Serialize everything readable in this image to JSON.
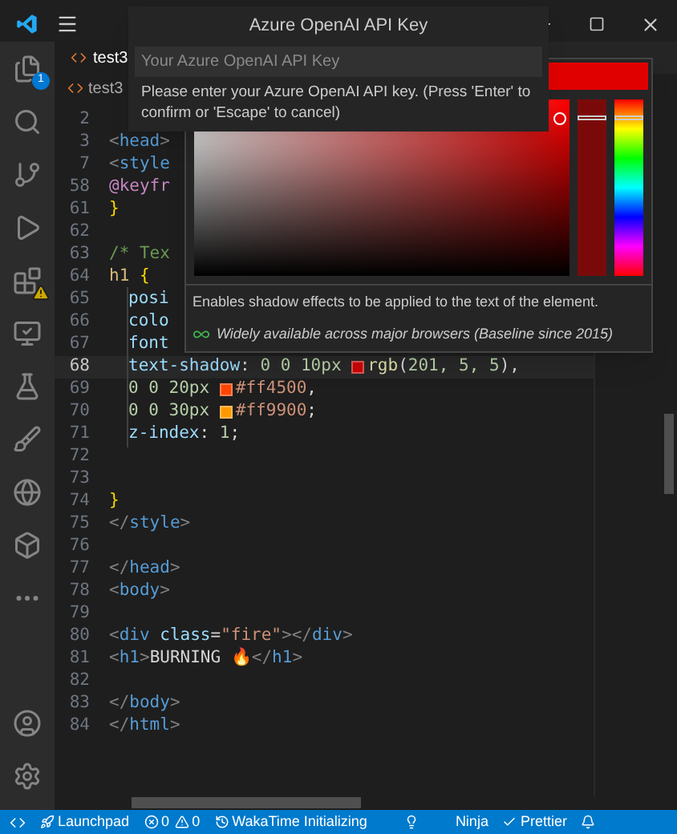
{
  "quick_input": {
    "title": "Azure OpenAI API Key",
    "placeholder": "Your Azure OpenAI API Key",
    "message": "Please enter your Azure OpenAI API key. (Press 'Enter' to confirm or 'Escape' to cancel)"
  },
  "activity_bar": [
    {
      "kind": "files",
      "badge": "1"
    },
    {
      "kind": "search"
    },
    {
      "kind": "git"
    },
    {
      "kind": "debug"
    },
    {
      "kind": "extensions",
      "warning": true
    },
    {
      "kind": "remote"
    },
    {
      "kind": "testing"
    },
    {
      "kind": "brush"
    },
    {
      "kind": "edge"
    },
    {
      "kind": "cube"
    },
    {
      "kind": "more"
    }
  ],
  "tab": {
    "label": "test3"
  },
  "breadcrumb": {
    "label": "test3"
  },
  "lines": [
    {
      "number": "2",
      "current": false
    },
    {
      "number": "3",
      "current": false,
      "indent": false,
      "tokens": [
        {
          "kind": "punct",
          "text": "<"
        },
        {
          "kind": "tag",
          "text": "head"
        },
        {
          "kind": "punct",
          "text": ">"
        }
      ]
    },
    {
      "number": "7",
      "current": false,
      "indent": false,
      "tokens": [
        {
          "kind": "punct",
          "text": "<"
        },
        {
          "kind": "tag",
          "text": "style"
        }
      ]
    },
    {
      "number": "58",
      "current": false,
      "indent": false,
      "tokens": [
        {
          "kind": "keyword",
          "text": "@keyfr"
        }
      ]
    },
    {
      "number": "61",
      "current": false,
      "indent": false,
      "tokens": [
        {
          "kind": "brace",
          "text": "}"
        }
      ]
    },
    {
      "number": "62",
      "current": false
    },
    {
      "number": "63",
      "current": false,
      "indent": false,
      "tokens": [
        {
          "kind": "comment",
          "text": "/* Tex"
        }
      ]
    },
    {
      "number": "64",
      "current": false,
      "indent": false,
      "tokens": [
        {
          "kind": "selector",
          "text": "h1 "
        },
        {
          "kind": "brace",
          "text": "{"
        }
      ]
    },
    {
      "number": "65",
      "current": false,
      "indent": true,
      "tokens": [
        {
          "kind": "property",
          "text": "posi"
        }
      ]
    },
    {
      "number": "66",
      "current": false,
      "indent": true,
      "tokens": [
        {
          "kind": "property",
          "text": "colo"
        }
      ]
    },
    {
      "number": "67",
      "current": false,
      "indent": true,
      "tokens": [
        {
          "kind": "property",
          "text": "font"
        }
      ]
    },
    {
      "number": "68",
      "current": true,
      "indent": true,
      "tokens": [
        {
          "kind": "property",
          "text": "text-shadow"
        },
        {
          "kind": "text",
          "text": ": "
        },
        {
          "kind": "number",
          "text": "0 0 10px "
        },
        {
          "kind": "swatch",
          "color": "#c90505"
        },
        {
          "kind": "function",
          "text": "rgb"
        },
        {
          "kind": "text",
          "text": "("
        },
        {
          "kind": "number",
          "text": "201, 5, 5"
        },
        {
          "kind": "text",
          "text": "),"
        }
      ]
    },
    {
      "number": "69",
      "current": false,
      "indent": true,
      "tokens": [
        {
          "kind": "number",
          "text": "0 0 20px "
        },
        {
          "kind": "swatch",
          "color": "#ff4500"
        },
        {
          "kind": "value",
          "text": "#ff4500"
        },
        {
          "kind": "text",
          "text": ","
        }
      ]
    },
    {
      "number": "70",
      "current": false,
      "indent": true,
      "tokens": [
        {
          "kind": "number",
          "text": "0 0 30px "
        },
        {
          "kind": "swatch",
          "color": "#ff9900"
        },
        {
          "kind": "value",
          "text": "#ff9900"
        },
        {
          "kind": "text",
          "text": ";"
        }
      ]
    },
    {
      "number": "71",
      "current": false,
      "indent": true,
      "tokens": [
        {
          "kind": "property",
          "text": "z-index"
        },
        {
          "kind": "text",
          "text": ": "
        },
        {
          "kind": "number",
          "text": "1"
        },
        {
          "kind": "text",
          "text": ";"
        }
      ]
    },
    {
      "number": "72",
      "current": false
    },
    {
      "number": "73",
      "current": false
    },
    {
      "number": "74",
      "current": false,
      "indent": false,
      "tokens": [
        {
          "kind": "brace",
          "text": "}"
        }
      ]
    },
    {
      "number": "75",
      "current": false,
      "indent": false,
      "tokens": [
        {
          "kind": "punct",
          "text": "</"
        },
        {
          "kind": "tag",
          "text": "style"
        },
        {
          "kind": "punct",
          "text": ">"
        }
      ]
    },
    {
      "number": "76",
      "current": false
    },
    {
      "number": "77",
      "current": false,
      "indent": false,
      "tokens": [
        {
          "kind": "punct",
          "text": "</"
        },
        {
          "kind": "tag",
          "text": "head"
        },
        {
          "kind": "punct",
          "text": ">"
        }
      ]
    },
    {
      "number": "78",
      "current": false,
      "indent": false,
      "tokens": [
        {
          "kind": "punct",
          "text": "<"
        },
        {
          "kind": "tag",
          "text": "body"
        },
        {
          "kind": "punct",
          "text": ">"
        }
      ]
    },
    {
      "number": "79",
      "current": false
    },
    {
      "number": "80",
      "current": false,
      "indent": false,
      "tokens": [
        {
          "kind": "punct",
          "text": "<"
        },
        {
          "kind": "tag",
          "text": "div "
        },
        {
          "kind": "attr",
          "text": "class"
        },
        {
          "kind": "text",
          "text": "="
        },
        {
          "kind": "string",
          "text": "\"fire\""
        },
        {
          "kind": "punct",
          "text": "></"
        },
        {
          "kind": "tag",
          "text": "div"
        },
        {
          "kind": "punct",
          "text": ">"
        }
      ]
    },
    {
      "number": "81",
      "current": false,
      "indent": false,
      "tokens": [
        {
          "kind": "punct",
          "text": "<"
        },
        {
          "kind": "tag",
          "text": "h1"
        },
        {
          "kind": "punct",
          "text": ">"
        },
        {
          "kind": "text",
          "text": "BURNING 🔥"
        },
        {
          "kind": "punct",
          "text": "</"
        },
        {
          "kind": "tag",
          "text": "h1"
        },
        {
          "kind": "punct",
          "text": ">"
        }
      ]
    },
    {
      "number": "82",
      "current": false
    },
    {
      "number": "83",
      "current": false,
      "indent": false,
      "tokens": [
        {
          "kind": "punct",
          "text": "</"
        },
        {
          "kind": "tag",
          "text": "body"
        },
        {
          "kind": "punct",
          "text": ">"
        }
      ]
    },
    {
      "number": "84",
      "current": false,
      "indent": false,
      "tokens": [
        {
          "kind": "punct",
          "text": "</"
        },
        {
          "kind": "tag",
          "text": "html"
        },
        {
          "kind": "punct",
          "text": ">"
        }
      ]
    }
  ],
  "color_picker": {
    "color": "#e00000"
  },
  "hover": {
    "description": "Enables shadow effects to be applied to the text of the element.",
    "baseline": "Widely available across major browsers (Baseline since 2015)"
  },
  "status_bar": [
    {
      "kind": "launchpad",
      "text": "Launchpad"
    },
    {
      "kind": "errors",
      "text": "0"
    },
    {
      "kind": "warnings",
      "text": "0"
    },
    {
      "kind": "wakatime",
      "text": "WakaTime Initializing"
    },
    {
      "kind": "bulb"
    },
    {
      "kind": "ninja",
      "text": "Ninja"
    },
    {
      "kind": "prettier",
      "text": "Prettier"
    },
    {
      "kind": "bell"
    }
  ]
}
